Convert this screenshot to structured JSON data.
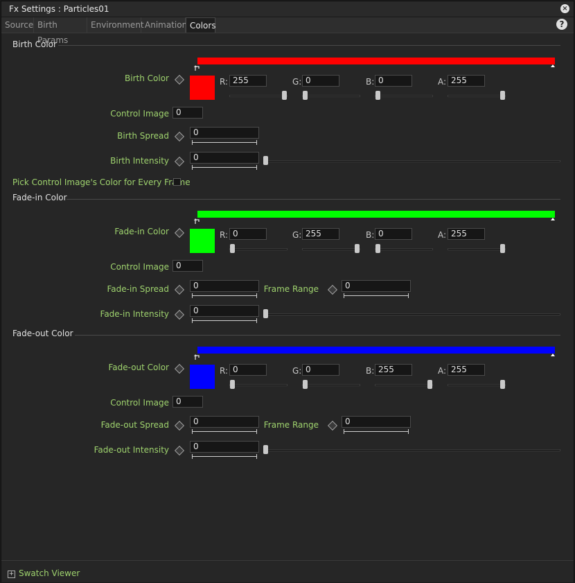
{
  "window": {
    "title": "Fx Settings : Particles01",
    "close_label": "×",
    "help_label": "?"
  },
  "tabs": [
    {
      "label": "Source"
    },
    {
      "label": "Birth Params"
    },
    {
      "label": "Environment"
    },
    {
      "label": "Animation"
    },
    {
      "label": "Colors",
      "active": true
    }
  ],
  "sections": {
    "birth": {
      "title": "Birth Color",
      "color_label": "Birth Color",
      "color_hex": "#ff0000",
      "r": "255",
      "g": "0",
      "b": "0",
      "a": "255",
      "r_level": 1.0,
      "g_level": 0.0,
      "b_level": 0.0,
      "a_level": 1.0,
      "control_image_label": "Control Image",
      "control_image": "0",
      "spread_label": "Birth Spread",
      "spread": "0",
      "intensity_label": "Birth Intensity",
      "intensity": "0",
      "pick_label": "Pick Control Image's Color for Every Frame"
    },
    "fadein": {
      "title": "Fade-in Color",
      "color_label": "Fade-in Color",
      "color_hex": "#00ff00",
      "r": "0",
      "g": "255",
      "b": "0",
      "a": "255",
      "r_level": 0.0,
      "g_level": 1.0,
      "b_level": 0.0,
      "a_level": 1.0,
      "control_image_label": "Control Image",
      "control_image": "0",
      "spread_label": "Fade-in Spread",
      "spread": "0",
      "frame_range_label": "Frame Range",
      "frame_range": "0",
      "intensity_label": "Fade-in Intensity",
      "intensity": "0"
    },
    "fadeout": {
      "title": "Fade-out Color",
      "color_label": "Fade-out Color",
      "color_hex": "#0000ff",
      "r": "0",
      "g": "0",
      "b": "255",
      "a": "255",
      "r_level": 0.0,
      "g_level": 0.0,
      "b_level": 1.0,
      "a_level": 1.0,
      "control_image_label": "Control Image",
      "control_image": "0",
      "spread_label": "Fade-out Spread",
      "spread": "0",
      "frame_range_label": "Frame Range",
      "frame_range": "0",
      "intensity_label": "Fade-out Intensity",
      "intensity": "0"
    }
  },
  "channel_labels": {
    "r": "R:",
    "g": "G:",
    "b": "B:",
    "a": "A:"
  },
  "footer": {
    "swatch_viewer": "Swatch Viewer",
    "expand": "+"
  },
  "colors": {
    "label_green": "#9fd36e",
    "panel_bg": "#262626"
  }
}
